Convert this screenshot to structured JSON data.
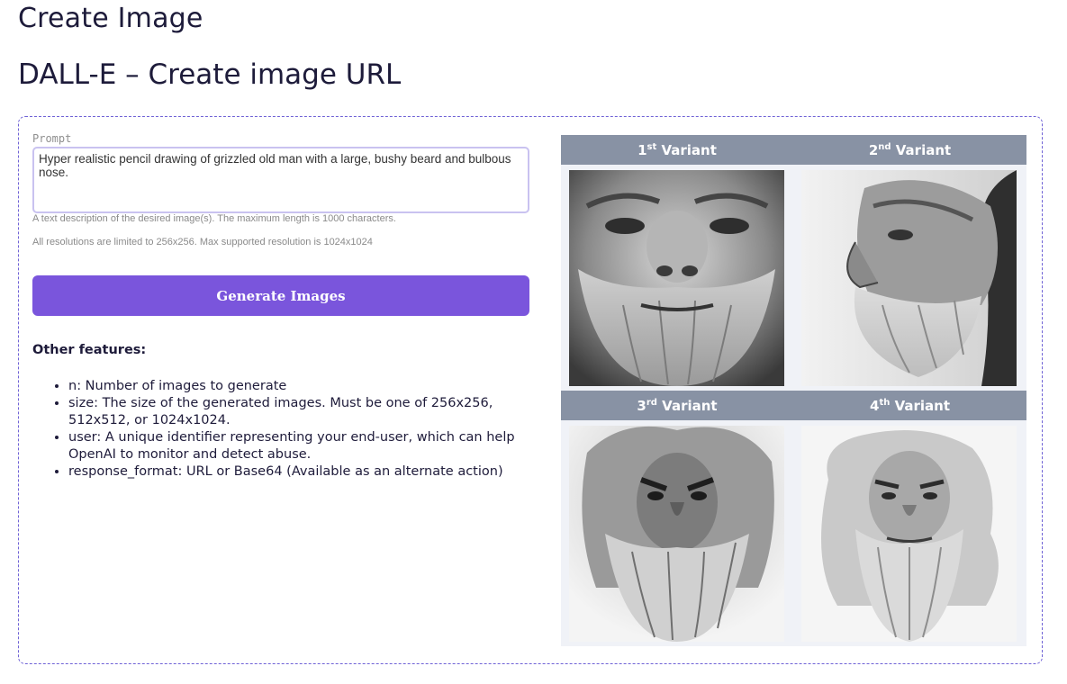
{
  "page": {
    "title": "Create Image",
    "section_title": "DALL-E – Create image URL"
  },
  "form": {
    "prompt_label": "Prompt",
    "prompt_value": "Hyper realistic pencil drawing of grizzled old man with a large, bushy beard and bulbous nose.",
    "helper_length": "A text description of the desired image(s). The maximum length is 1000 characters.",
    "helper_resolution": "All resolutions are limited to 256x256.  Max supported resolution is 1024x1024",
    "generate_label": "Generate Images"
  },
  "features": {
    "heading": "Other features:",
    "items": [
      "n: Number of images to generate",
      "size: The size of the generated images. Must be one of 256x256, 512x512, or 1024x1024.",
      "user: A unique identifier representing your end-user, which can help OpenAI to monitor and detect abuse.",
      "response_format: URL or Base64 (Available as an alternate action)"
    ]
  },
  "variants": [
    {
      "num": "1",
      "suffix": "st",
      "label": "Variant"
    },
    {
      "num": "2",
      "suffix": "nd",
      "label": "Variant"
    },
    {
      "num": "3",
      "suffix": "rd",
      "label": "Variant"
    },
    {
      "num": "4",
      "suffix": "th",
      "label": "Variant"
    }
  ],
  "colors": {
    "accent": "#7a55dc",
    "header_bg": "#8892a4",
    "panel_border": "#6f62d6",
    "gallery_bg": "#f0f2f7"
  }
}
